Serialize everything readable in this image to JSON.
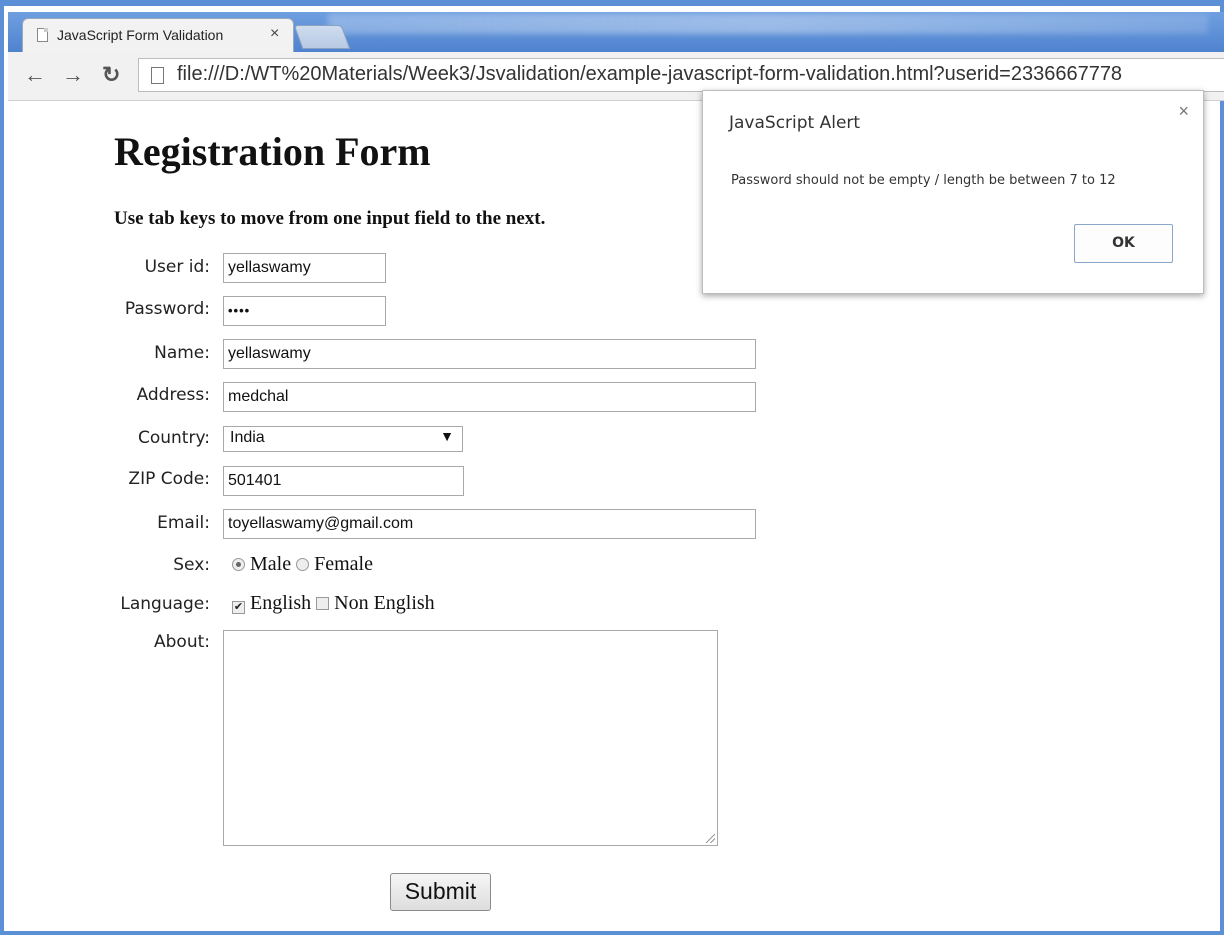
{
  "browser": {
    "tab_title": "JavaScript Form Validation",
    "tab_close": "×",
    "url": "file:///D:/WT%20Materials/Week3/Jsvalidation/example-javascript-form-validation.html?userid=2336667778"
  },
  "form": {
    "title": "Registration Form",
    "instruction": "Use tab keys to move from one input field to the next.",
    "labels": {
      "userid": "User id:",
      "password": "Password:",
      "name": "Name:",
      "address": "Address:",
      "country": "Country:",
      "zip": "ZIP Code:",
      "email": "Email:",
      "sex": "Sex:",
      "language": "Language:",
      "about": "About:"
    },
    "values": {
      "userid": "yellaswamy",
      "password": "••••",
      "name": "yellaswamy",
      "address": "medchal",
      "country": "India",
      "zip": "501401",
      "email": "toyellaswamy@gmail.com",
      "about": ""
    },
    "sex_options": {
      "male": "Male",
      "female": "Female",
      "selected": "Male"
    },
    "language_options": {
      "english": "English",
      "non_english": "Non English",
      "checked": [
        "English"
      ]
    },
    "submit_label": "Submit"
  },
  "alert": {
    "title": "JavaScript Alert",
    "message": "Password should not be empty / length be between 7 to 12",
    "ok_label": "OK",
    "close": "×"
  }
}
